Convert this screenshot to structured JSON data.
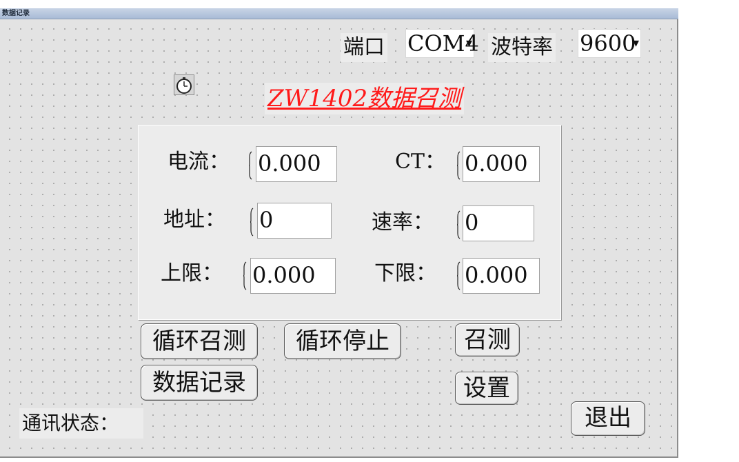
{
  "window": {
    "title": "数据记录"
  },
  "header": {
    "port_label": "端口",
    "port_value": "COM4",
    "baud_label": "波特率",
    "baud_value": "9600",
    "main_title": "ZW1402数据召测"
  },
  "panel": {
    "current_label": "电流：",
    "current_value": "0.000",
    "ct_label": "CT：",
    "ct_value": "0.000",
    "address_label": "地址：",
    "address_value": "0",
    "rate_label": "速率：",
    "rate_value": "0",
    "upper_label": "上限：",
    "upper_value": "0.000",
    "lower_label": "下限：",
    "lower_value": "0.000"
  },
  "buttons": {
    "cycle_poll": "循环召测",
    "cycle_stop": "循环停止",
    "poll": "召测",
    "data_record": "数据记录",
    "settings": "设置",
    "exit": "退出"
  },
  "status": {
    "label": "通讯状态："
  }
}
